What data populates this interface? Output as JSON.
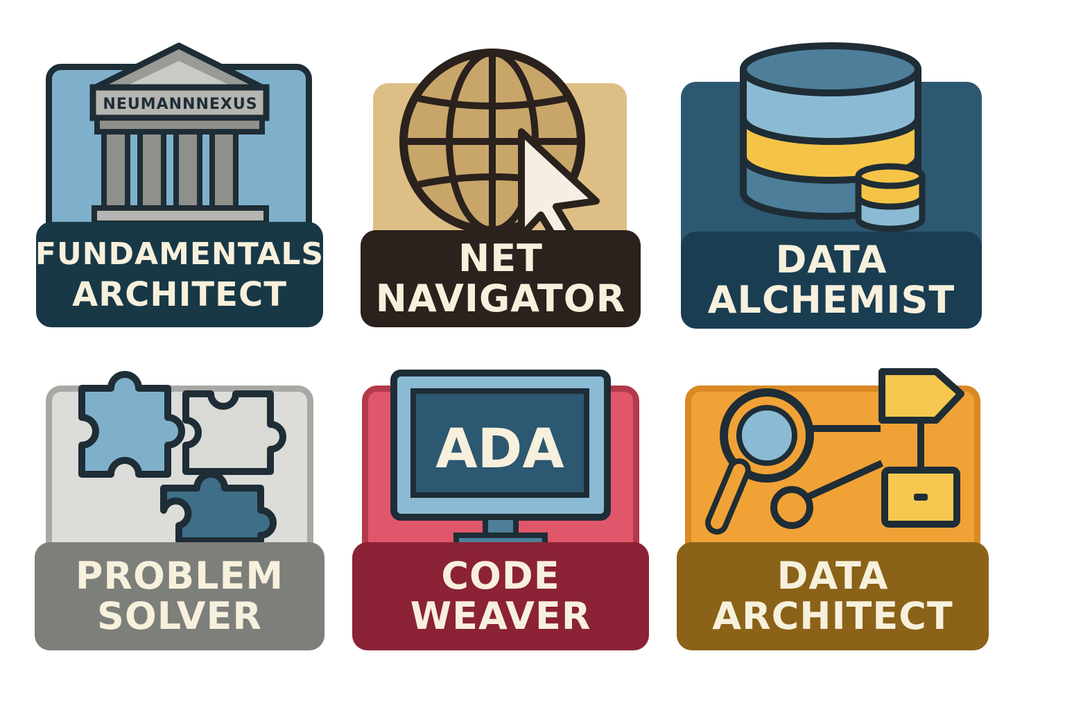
{
  "badges": [
    {
      "id": "fundamentals-architect",
      "icon": "temple-icon",
      "sign_text": "NEUMANNNEXUS",
      "line1": "FUNDAMENTALS",
      "line2": "ARCHITECT",
      "panel_color": "#7fb0cb",
      "label_color": "#183846"
    },
    {
      "id": "net-navigator",
      "icon": "globe-cursor-icon",
      "line1": "NET",
      "line2": "NAVIGATOR",
      "panel_color": "#ddbf86",
      "label_color": "#2b211d"
    },
    {
      "id": "data-alchemist",
      "icon": "database-icon",
      "line1": "DATA",
      "line2": "ALCHEMIST",
      "panel_color": "#2d5871",
      "label_color": "#1a3d52"
    },
    {
      "id": "problem-solver",
      "icon": "puzzle-icon",
      "line1": "PROBLEM",
      "line2": "SOLVER",
      "panel_color": "#dcdcd9",
      "label_color": "#7d7f7b"
    },
    {
      "id": "code-weaver",
      "icon": "monitor-icon",
      "screen_text": "ADA",
      "line1": "CODE",
      "line2": "WEAVER",
      "panel_color": "#e0566a",
      "label_color": "#8b2236"
    },
    {
      "id": "data-architect",
      "icon": "magnifier-diagram-icon",
      "line1": "DATA",
      "line2": "ARCHITECT",
      "panel_color": "#f0a236",
      "label_color": "#8a6218"
    }
  ]
}
